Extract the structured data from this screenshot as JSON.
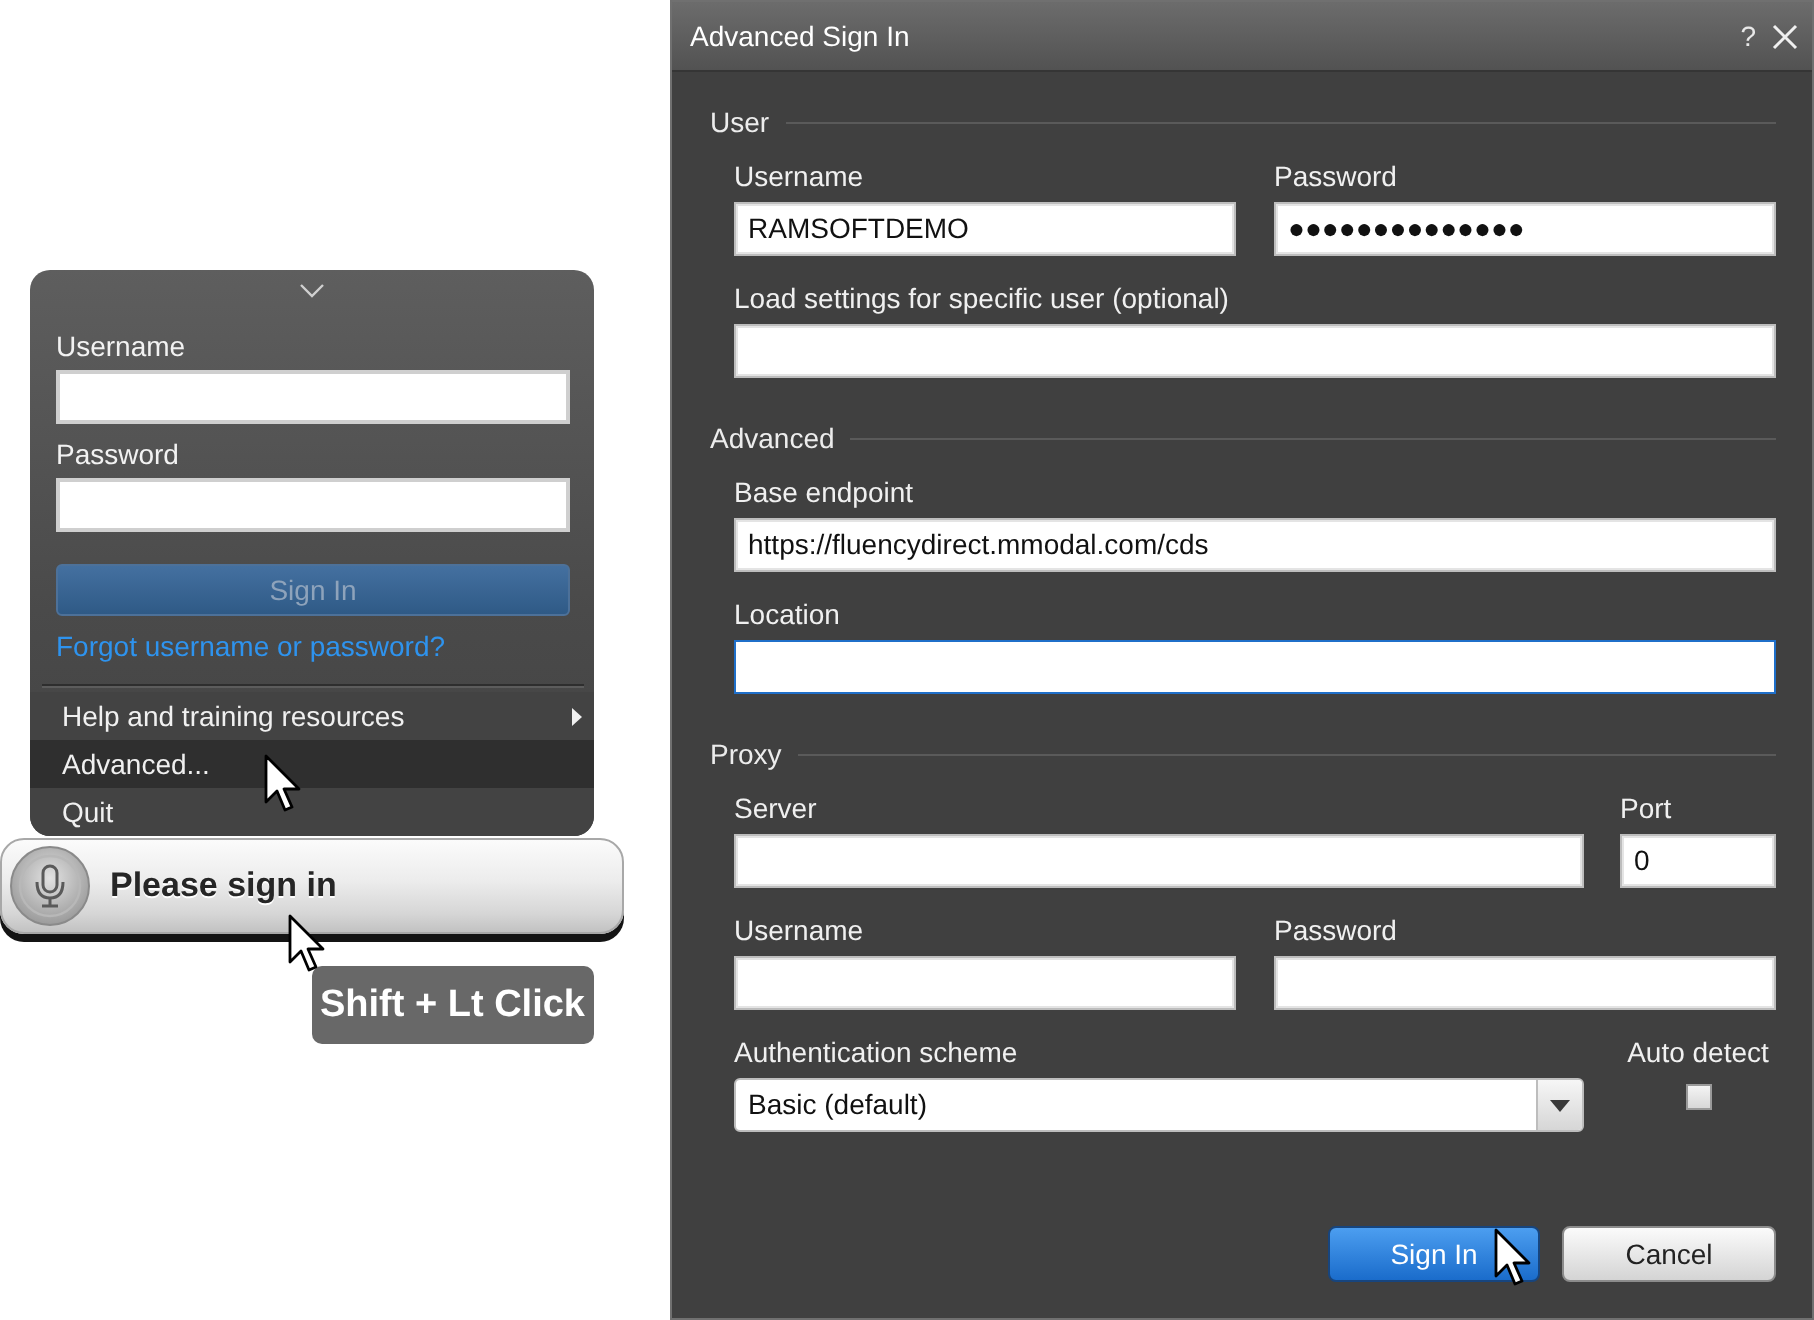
{
  "login_panel": {
    "fields": [
      {
        "label": "Username"
      },
      {
        "label": "Password"
      }
    ],
    "sign_in_button": {
      "label": "Sign In",
      "disabled": true
    },
    "forgot_link": "Forgot username or password?",
    "menu": [
      {
        "label": "Help and training resources",
        "submenu": true,
        "selected": false
      },
      {
        "label": "Advanced...",
        "submenu": false,
        "selected": true
      },
      {
        "label": "Quit",
        "submenu": false,
        "selected": false
      }
    ]
  },
  "status_bar": {
    "label": "Please sign in"
  },
  "tooltip": {
    "label": "Shift + Lt Click"
  },
  "dialog": {
    "title": "Advanced Sign In",
    "help": "?",
    "sections": [
      {
        "heading": "User",
        "rows": [
          [
            {
              "kind": "text",
              "label": "Username",
              "value": "RAMSOFTDEMO",
              "focused": false
            },
            {
              "kind": "text",
              "label": "Password",
              "value": "●●●●●●●●●●●●●●",
              "focused": false
            }
          ],
          [
            {
              "kind": "text",
              "label": "Load settings for specific user (optional)",
              "focused": false
            }
          ]
        ]
      },
      {
        "heading": "Advanced",
        "rows": [
          [
            {
              "kind": "text",
              "label": "Base endpoint",
              "value": "https://fluencydirect.mmodal.com/cds",
              "focused": false
            }
          ],
          [
            {
              "kind": "text",
              "label": "Location",
              "focused": true
            }
          ]
        ]
      },
      {
        "heading": "Proxy",
        "rows": [
          [
            {
              "kind": "text",
              "label": "Server",
              "focused": false
            },
            {
              "kind": "number",
              "label": "Port",
              "value": "0",
              "focused": false
            }
          ],
          [
            {
              "kind": "text",
              "label": "Username",
              "focused": false
            },
            {
              "kind": "text",
              "label": "Password",
              "focused": false
            }
          ],
          [
            {
              "kind": "dropdown",
              "label": "Authentication scheme",
              "value": "Basic (default)",
              "focused": false
            },
            {
              "kind": "checkbox",
              "label": "Auto detect",
              "checked": false,
              "focused": false
            }
          ]
        ]
      }
    ],
    "buttons": [
      {
        "kind": "primary",
        "label": "Sign In"
      },
      {
        "kind": "secondary",
        "label": "Cancel"
      }
    ]
  }
}
